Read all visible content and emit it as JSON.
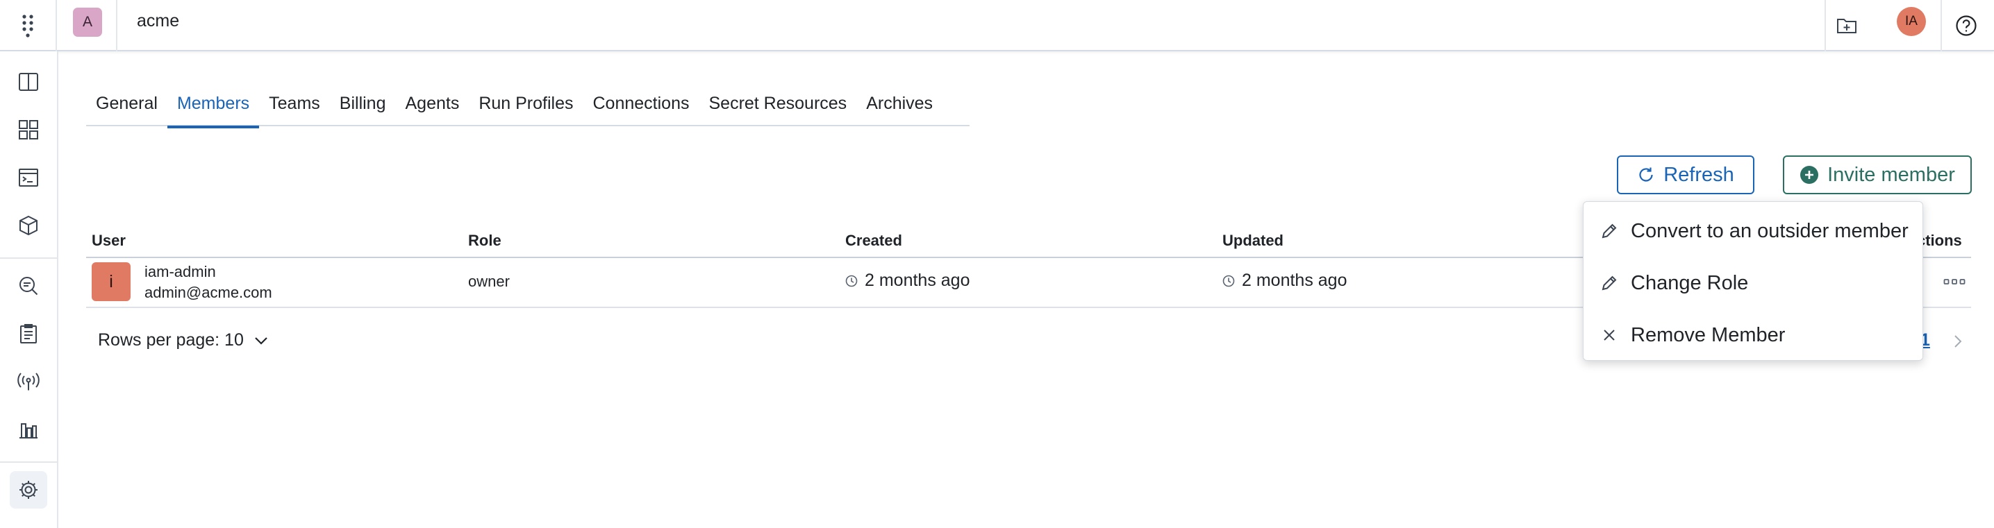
{
  "topbar": {
    "org_initial": "A",
    "org_name": "acme",
    "user_initials": "IA",
    "icons": [
      "apps-grid-icon",
      "folder-plus-icon",
      "help-icon"
    ]
  },
  "sidebar": {
    "items": [
      {
        "icon": "book-open-icon"
      },
      {
        "icon": "dashboard-grid-icon"
      },
      {
        "icon": "terminal-icon"
      },
      {
        "icon": "cube-icon"
      },
      {
        "icon": "search-logs-icon"
      },
      {
        "icon": "clipboard-icon"
      },
      {
        "icon": "broadcast-icon"
      },
      {
        "icon": "chart-icon"
      },
      {
        "icon": "gear-icon"
      }
    ]
  },
  "tabs": [
    "General",
    "Members",
    "Teams",
    "Billing",
    "Agents",
    "Run Profiles",
    "Connections",
    "Secret Resources",
    "Archives"
  ],
  "active_tab": "Members",
  "buttons": {
    "refresh_label": "Refresh",
    "invite_label": "Invite member"
  },
  "table": {
    "headers": {
      "user": "User",
      "role": "Role",
      "created": "Created",
      "updated": "Updated",
      "actions": "ctions"
    },
    "rows": [
      {
        "initial": "i",
        "name": "iam-admin",
        "email": "admin@acme.com",
        "role": "owner",
        "created": "2 months ago",
        "updated": "2 months ago"
      }
    ]
  },
  "pagination": {
    "rows_per_page": "Rows per page: 10",
    "page": "1"
  },
  "menu": {
    "items": [
      "Convert to an outsider member",
      "Change Role",
      "Remove Member"
    ]
  },
  "colors": {
    "accent_blue": "#1a64b8",
    "accent_green": "#2b6f63",
    "avatar_orange": "#e07a63",
    "org_pink": "#d9a6c8"
  }
}
